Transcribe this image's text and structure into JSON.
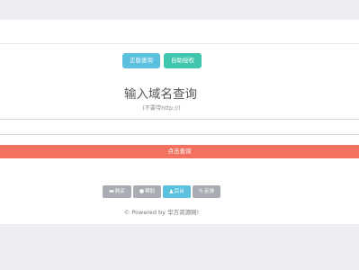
{
  "tabs": [
    {
      "label": "正版查询"
    },
    {
      "label": "自助授权"
    }
  ],
  "search": {
    "title": "输入域名查询",
    "hint": "(不要带http://)",
    "input_value": "",
    "submit_label": "点击查询"
  },
  "footer": {
    "buttons": [
      {
        "label": "购买",
        "icon": "cart-icon"
      },
      {
        "label": "帮助",
        "icon": "info-icon"
      },
      {
        "label": "后台",
        "icon": "user-icon"
      },
      {
        "label": "反馈",
        "icon": "edit-icon"
      }
    ],
    "powered_by": "© Powered by 华方资源网!"
  },
  "colors": {
    "page_bg": "#ececf1",
    "tab_query": "#5bc0de",
    "tab_auth": "#3fc6ad",
    "submit": "#f2725f",
    "footer_btn": "#a9adb3",
    "footer_active": "#5bc0de"
  }
}
